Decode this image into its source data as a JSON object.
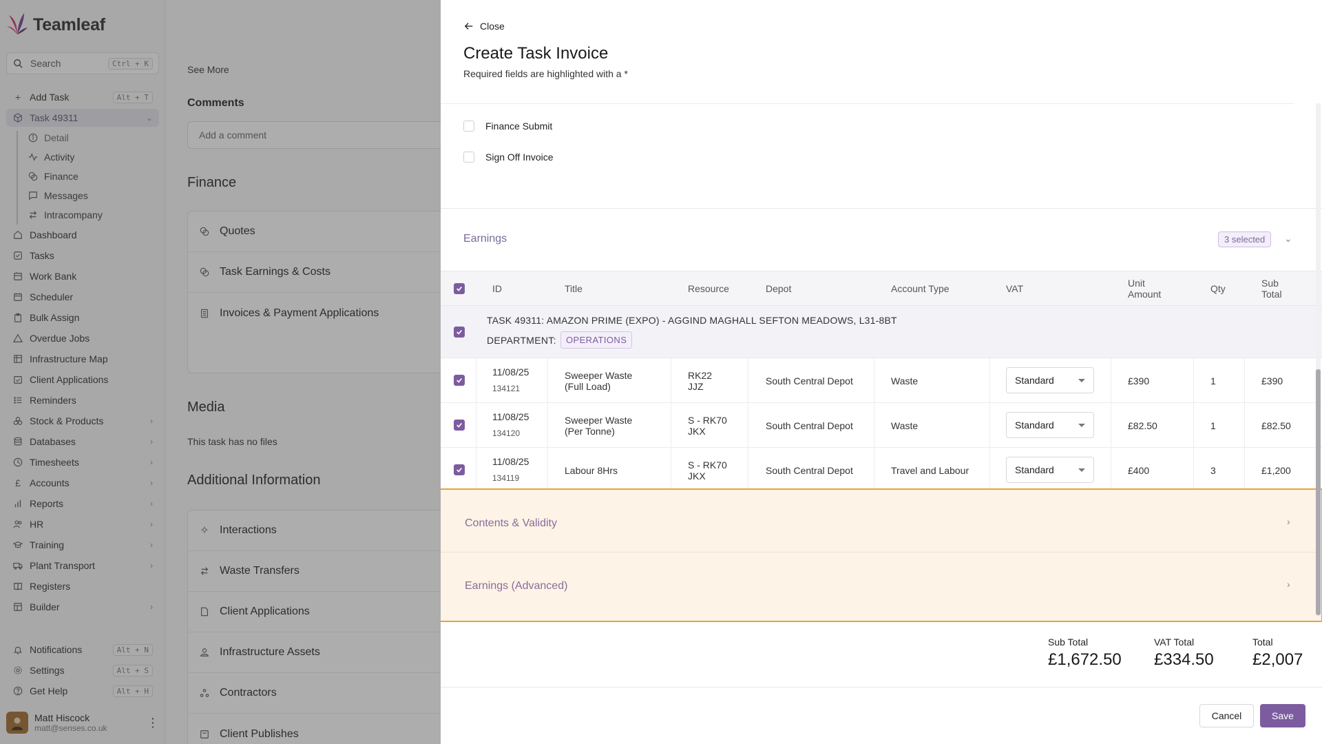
{
  "app": {
    "name": "Teamleaf",
    "brand_color": "#7c5c9f"
  },
  "sidebar": {
    "search": {
      "label": "Search",
      "shortcut": "Ctrl + K"
    },
    "add_task": {
      "label": "Add Task",
      "shortcut": "Alt + T"
    },
    "current_task": {
      "label": "Task 49311"
    },
    "task_sub_items": [
      {
        "label": "Detail",
        "icon": "info-icon"
      },
      {
        "label": "Activity",
        "icon": "activity-icon"
      },
      {
        "label": "Finance",
        "icon": "coins-icon"
      },
      {
        "label": "Messages",
        "icon": "message-icon"
      },
      {
        "label": "Intracompany",
        "icon": "transfer-icon"
      }
    ],
    "items": [
      {
        "label": "Dashboard",
        "icon": "home-icon",
        "expandable": false
      },
      {
        "label": "Tasks",
        "icon": "tasks-icon",
        "expandable": false
      },
      {
        "label": "Work Bank",
        "icon": "bank-icon",
        "expandable": false
      },
      {
        "label": "Scheduler",
        "icon": "calendar-icon",
        "expandable": false
      },
      {
        "label": "Bulk Assign",
        "icon": "clipboard-icon",
        "expandable": false
      },
      {
        "label": "Overdue Jobs",
        "icon": "warning-icon",
        "expandable": false
      },
      {
        "label": "Infrastructure Map",
        "icon": "map-icon",
        "expandable": false
      },
      {
        "label": "Client Applications",
        "icon": "calendar-check-icon",
        "expandable": false
      },
      {
        "label": "Reminders",
        "icon": "list-icon",
        "expandable": false
      },
      {
        "label": "Stock & Products",
        "icon": "boxes-icon",
        "expandable": true
      },
      {
        "label": "Databases",
        "icon": "database-icon",
        "expandable": true
      },
      {
        "label": "Timesheets",
        "icon": "clock-icon",
        "expandable": true
      },
      {
        "label": "Accounts",
        "icon": "pound-icon",
        "expandable": true
      },
      {
        "label": "Reports",
        "icon": "bar-chart-icon",
        "expandable": true
      },
      {
        "label": "HR",
        "icon": "users-icon",
        "expandable": true
      },
      {
        "label": "Training",
        "icon": "graduation-icon",
        "expandable": true
      },
      {
        "label": "Plant Transport",
        "icon": "truck-icon",
        "expandable": true
      },
      {
        "label": "Registers",
        "icon": "book-icon",
        "expandable": false
      },
      {
        "label": "Builder",
        "icon": "layout-icon",
        "expandable": true
      }
    ],
    "bottom": [
      {
        "label": "Notifications",
        "icon": "bell-icon",
        "shortcut": "Alt + N"
      },
      {
        "label": "Settings",
        "icon": "gear-icon",
        "shortcut": "Alt + S"
      },
      {
        "label": "Get Help",
        "icon": "help-icon",
        "shortcut": "Alt + H"
      }
    ],
    "user": {
      "name": "Matt Hiscock",
      "email": "matt@senses.co.uk"
    }
  },
  "page": {
    "see_more": "See More",
    "comments_heading": "Comments",
    "comment_placeholder": "Add a comment",
    "finance_heading": "Finance",
    "finance_items": [
      {
        "label": "Quotes",
        "icon": "coins-icon"
      },
      {
        "label": "Task Earnings & Costs",
        "icon": "coins-icon"
      },
      {
        "label": "Invoices & Payment Applications",
        "icon": "document-icon"
      }
    ],
    "media_heading": "Media",
    "media_text": "This task has no files",
    "additional_heading": "Additional Information",
    "additional_items": [
      {
        "label": "Interactions",
        "icon": "sparkle-icon"
      },
      {
        "label": "Waste Transfers",
        "icon": "transfer-icon"
      },
      {
        "label": "Client Applications",
        "icon": "file-icon"
      },
      {
        "label": "Infrastructure Assets",
        "icon": "asset-icon"
      },
      {
        "label": "Contractors",
        "icon": "contractors-icon"
      },
      {
        "label": "Client Publishes",
        "icon": "publish-icon"
      }
    ]
  },
  "drawer": {
    "close_label": "Close",
    "title": "Create Task Invoice",
    "subtitle": "Required fields are highlighted with a *",
    "checkboxes": [
      {
        "label": "Finance Submit",
        "checked": false
      },
      {
        "label": "Sign Off Invoice",
        "checked": false
      }
    ],
    "earnings": {
      "title": "Earnings",
      "selected_badge": "3 selected",
      "columns": {
        "id": "ID",
        "title": "Title",
        "resource": "Resource",
        "depot": "Depot",
        "account_type": "Account Type",
        "vat": "VAT",
        "unit_amount_1": "Unit",
        "unit_amount_2": "Amount",
        "qty": "Qty",
        "sub_total_1": "Sub",
        "sub_total_2": "Total"
      },
      "group": {
        "title": "TASK 49311: AMAZON PRIME (EXPO) - AGGIND MAGHALL SEFTON MEADOWS, L31-8BT",
        "department_label": "DEPARTMENT:",
        "department": "OPERATIONS"
      },
      "rows": [
        {
          "date": "11/08/25",
          "id": "134121",
          "title_1": "Sweeper Waste",
          "title_2": "(Full Load)",
          "resource_1": "RK22",
          "resource_2": "JJZ",
          "depot": "South Central Depot",
          "account_type": "Waste",
          "vat": "Standard",
          "unit_amount": "£390",
          "qty": "1",
          "sub_total": "£390"
        },
        {
          "date": "11/08/25",
          "id": "134120",
          "title_1": "Sweeper Waste",
          "title_2": "(Per Tonne)",
          "resource_1": "S - RK70",
          "resource_2": "JKX",
          "depot": "South Central Depot",
          "account_type": "Waste",
          "vat": "Standard",
          "unit_amount": "£82.50",
          "qty": "1",
          "sub_total": "£82.50"
        },
        {
          "date": "11/08/25",
          "id": "134119",
          "title_1": "Labour 8Hrs",
          "title_2": "",
          "resource_1": "S - RK70",
          "resource_2": "JKX",
          "depot": "South Central Depot",
          "account_type": "Travel and Labour",
          "vat": "Standard",
          "unit_amount": "£400",
          "qty": "3",
          "sub_total": "£1,200"
        }
      ]
    },
    "accordions": [
      {
        "label": "Contents & Validity"
      },
      {
        "label": "Earnings (Advanced)"
      }
    ],
    "totals": {
      "sub_total_label": "Sub Total",
      "sub_total": "£1,672.50",
      "vat_total_label": "VAT Total",
      "vat_total": "£334.50",
      "total_label": "Total",
      "total": "£2,007"
    },
    "cancel_label": "Cancel",
    "save_label": "Save"
  }
}
